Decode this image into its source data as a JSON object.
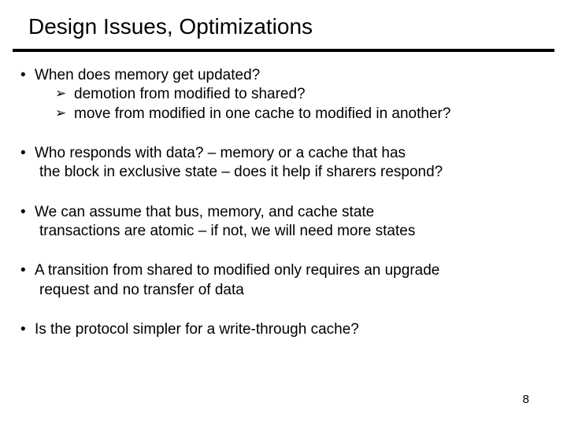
{
  "title": "Design Issues, Optimizations",
  "bullets": {
    "b1": {
      "line1": "When does memory get updated?",
      "sub1": "demotion from modified to shared?",
      "sub2": "move from modified in one cache to modified in another?"
    },
    "b2": {
      "line1": "Who responds with data?  – memory or a cache that has",
      "line2": "the block in exclusive state – does it help if sharers respond?"
    },
    "b3": {
      "line1": "We can assume that bus, memory, and cache state",
      "line2": "transactions are atomic – if not, we will need more states"
    },
    "b4": {
      "line1": "A transition from shared to modified only requires an upgrade",
      "line2": "request and no transfer of data"
    },
    "b5": {
      "line1": "Is the protocol simpler for a write-through cache?"
    }
  },
  "marks": {
    "dot": "•",
    "arrow": "➢"
  },
  "page_number": "8"
}
